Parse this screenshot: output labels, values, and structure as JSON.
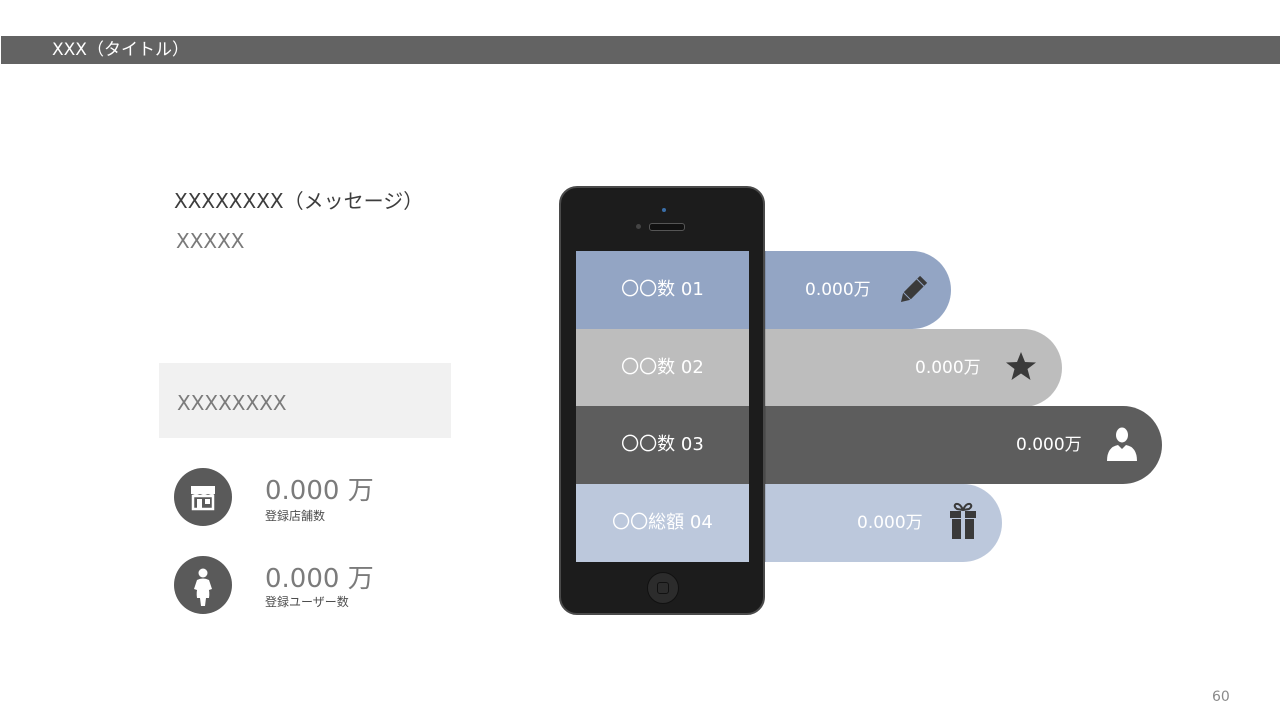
{
  "header": {
    "title": "XXX（タイトル）"
  },
  "message": {
    "main": "XXXXXXXX（メッセージ）",
    "sub": "XXXXX"
  },
  "highlight_box": {
    "text": "XXXXXXXX"
  },
  "stats": [
    {
      "value": "0.000 万",
      "label": "登録店舗数",
      "icon": "store-icon"
    },
    {
      "value": "0.000 万",
      "label": "登録ユーザー数",
      "icon": "person-icon"
    }
  ],
  "phone_rows": [
    {
      "label": "〇〇数  01",
      "value": "0.000万",
      "icon": "pencil-icon",
      "color": "#93a5c4"
    },
    {
      "label": "〇〇数  02",
      "value": "0.000万",
      "icon": "star-icon",
      "color": "#bdbdbd"
    },
    {
      "label": "〇〇数  03",
      "value": "0.000万",
      "icon": "user-icon",
      "color": "#5d5d5d"
    },
    {
      "label": "〇〇総額  04",
      "value": "0.000万",
      "icon": "gift-icon",
      "color": "#bcc8dc"
    }
  ],
  "page_number": "60"
}
